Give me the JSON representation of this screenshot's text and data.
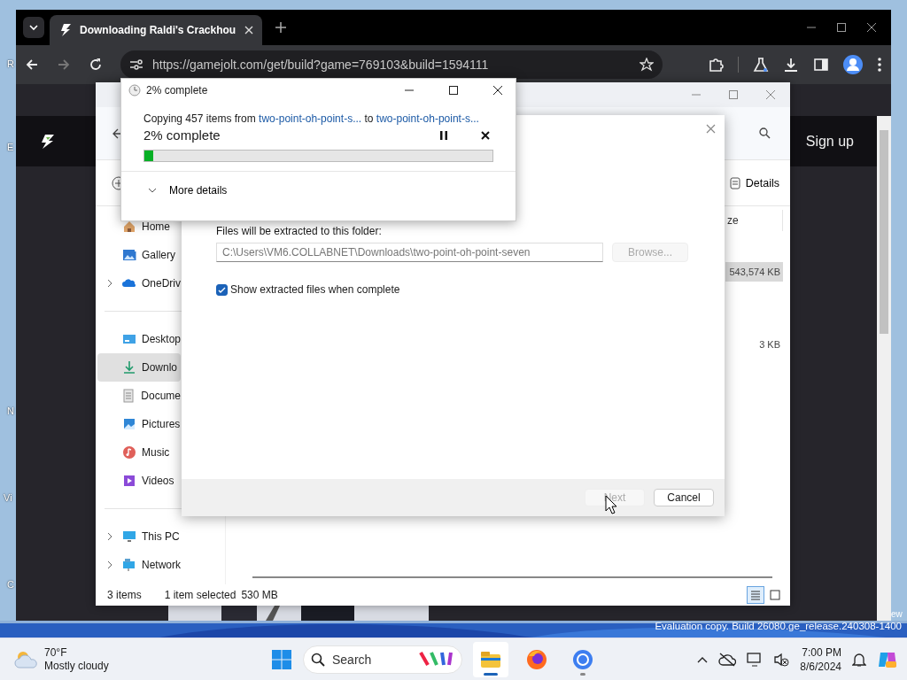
{
  "desktop": {
    "icon_labels": [
      "R",
      "E",
      "N",
      "Vi",
      "C"
    ],
    "corner_text": "ew",
    "watermark": "Evaluation copy. Build 26080.ge_release.240308-1400"
  },
  "browser": {
    "tab": {
      "title": "Downloading Raldi's Crackhou",
      "selected": true
    },
    "address": "https://gamejolt.com/get/build?game=769103&build=1594111",
    "page": {
      "sign_up": "Sign up"
    }
  },
  "explorer": {
    "nav_groups": [
      {
        "items": [
          {
            "kind": "home",
            "label": "Home",
            "expandable": false,
            "selected": false
          },
          {
            "kind": "gallery",
            "label": "Gallery",
            "expandable": false,
            "selected": false
          },
          {
            "kind": "cloud",
            "label": "OneDriv",
            "expandable": true,
            "selected": false
          }
        ]
      },
      {
        "items": [
          {
            "kind": "desktop",
            "label": "Desktop",
            "expandable": false,
            "selected": false
          },
          {
            "kind": "download",
            "label": "Downlo",
            "expandable": false,
            "selected": true
          },
          {
            "kind": "document",
            "label": "Docume",
            "expandable": false,
            "selected": false
          },
          {
            "kind": "pictures",
            "label": "Pictures",
            "expandable": false,
            "selected": false
          },
          {
            "kind": "music",
            "label": "Music",
            "expandable": false,
            "selected": false
          },
          {
            "kind": "videos",
            "label": "Videos",
            "expandable": false,
            "selected": false
          }
        ]
      },
      {
        "items": [
          {
            "kind": "pc",
            "label": "This PC",
            "expandable": true,
            "selected": false
          },
          {
            "kind": "network",
            "label": "Network",
            "expandable": true,
            "selected": false
          }
        ]
      }
    ],
    "details": "Details",
    "column_3": "ze",
    "rows": [
      {
        "size": "543,574 KB",
        "selected": true
      },
      {
        "size": "3 KB",
        "selected": false
      }
    ],
    "status": {
      "count": "3 items",
      "selection": "1 item selected",
      "size": "530 MB"
    }
  },
  "extract_dialog": {
    "label": "Files will be extracted to this folder:",
    "path": "C:\\Users\\VM6.COLLABNET\\Downloads\\two-point-oh-point-seven",
    "browse": {
      "label": "Browse...",
      "disabled": true
    },
    "show_files": {
      "label": "Show extracted files when complete",
      "checked": true
    },
    "buttons": [
      {
        "label": "Next",
        "disabled": true
      },
      {
        "label": "Cancel",
        "disabled": false
      }
    ]
  },
  "progress_dialog": {
    "title": "2% complete",
    "copying": "Copying 457 items from",
    "source": "two-point-oh-point-s...",
    "to": "to",
    "destination": "two-point-oh-point-s...",
    "status": "2% complete",
    "level": 0.02,
    "more": "More details"
  },
  "taskbar": {
    "weather": {
      "temp": "70°F",
      "condition": "Mostly cloudy"
    },
    "search": "Search",
    "apps": [
      {
        "kind": "explorer",
        "open": true,
        "focused": true
      },
      {
        "kind": "firefox",
        "open": false,
        "focused": false
      },
      {
        "kind": "chrome",
        "open": true,
        "focused": false
      }
    ],
    "clock": {
      "time": "7:00 PM",
      "date": "8/6/2024"
    }
  }
}
